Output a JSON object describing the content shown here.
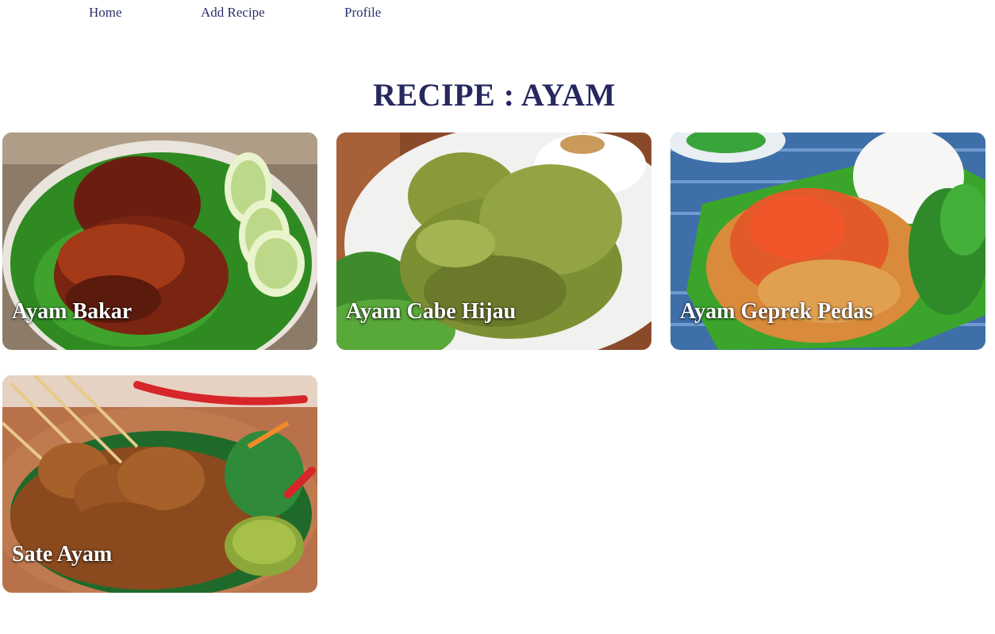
{
  "nav": {
    "home": "Home",
    "add_recipe": "Add Recipe",
    "profile": "Profile"
  },
  "page": {
    "title": "RECIPE : AYAM"
  },
  "recipes": [
    {
      "name": "Ayam Bakar"
    },
    {
      "name": "Ayam Cabe Hijau"
    },
    {
      "name": "Ayam Geprek Pedas"
    },
    {
      "name": "Sate Ayam"
    }
  ]
}
